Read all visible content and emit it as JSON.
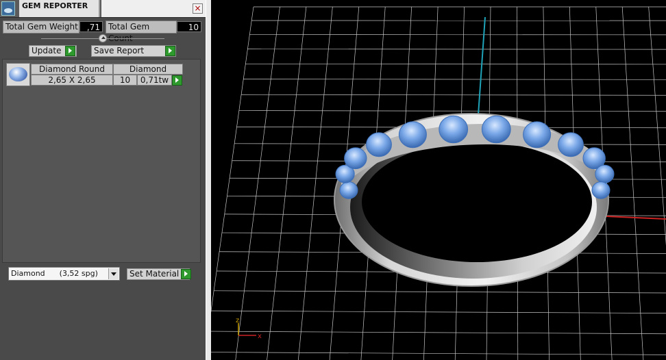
{
  "window": {
    "title": "GEM REPORTER",
    "close_glyph": "×"
  },
  "stats": {
    "total_weight_label": "Total Gem Weight",
    "total_weight_value": ",71",
    "total_count_label": "Total Gem Count",
    "total_count_value": "10"
  },
  "buttons": {
    "update": "Update",
    "save_report": "Save Report",
    "set_material": "Set Material"
  },
  "gem_list": {
    "rows": [
      {
        "cut": "Diamond Round",
        "material": "Diamond",
        "size": "2,65 X 2,65",
        "count": "10",
        "weight": "0,71tw"
      }
    ]
  },
  "material_select": {
    "value": "Diamond      (3,52 spg)"
  },
  "viewport": {
    "axis_labels": {
      "x": "x",
      "z": "z"
    },
    "colors": {
      "grid": "#c8c8c8",
      "x_axis": "#cc2222",
      "y_axis": "#1fa3b8",
      "metal": "#d9d9d9",
      "gem": "#7aa8e8"
    }
  },
  "icons": {
    "title": "gem-reporter-app-icon",
    "close": "close-icon",
    "go": "play-arrow-icon",
    "gem": "round-diamond-icon",
    "dropdown": "chevron-down-icon"
  }
}
